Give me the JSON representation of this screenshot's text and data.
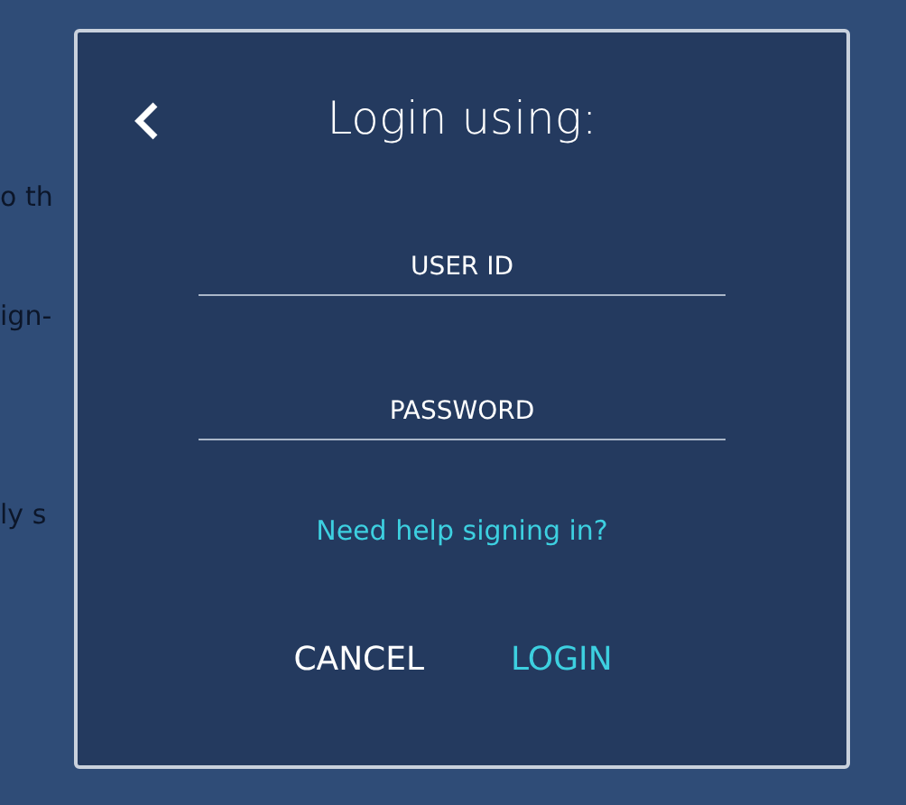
{
  "background": {
    "left_column": [
      "o th",
      "ign-",
      "ly s"
    ]
  },
  "dialog": {
    "title": "Login using:",
    "fields": [
      {
        "placeholder": "USER ID"
      },
      {
        "placeholder": "PASSWORD"
      }
    ],
    "help_link": "Need help signing in?",
    "buttons": [
      {
        "label": "CANCEL",
        "primary": false
      },
      {
        "label": "LOGIN",
        "primary": true
      }
    ]
  }
}
